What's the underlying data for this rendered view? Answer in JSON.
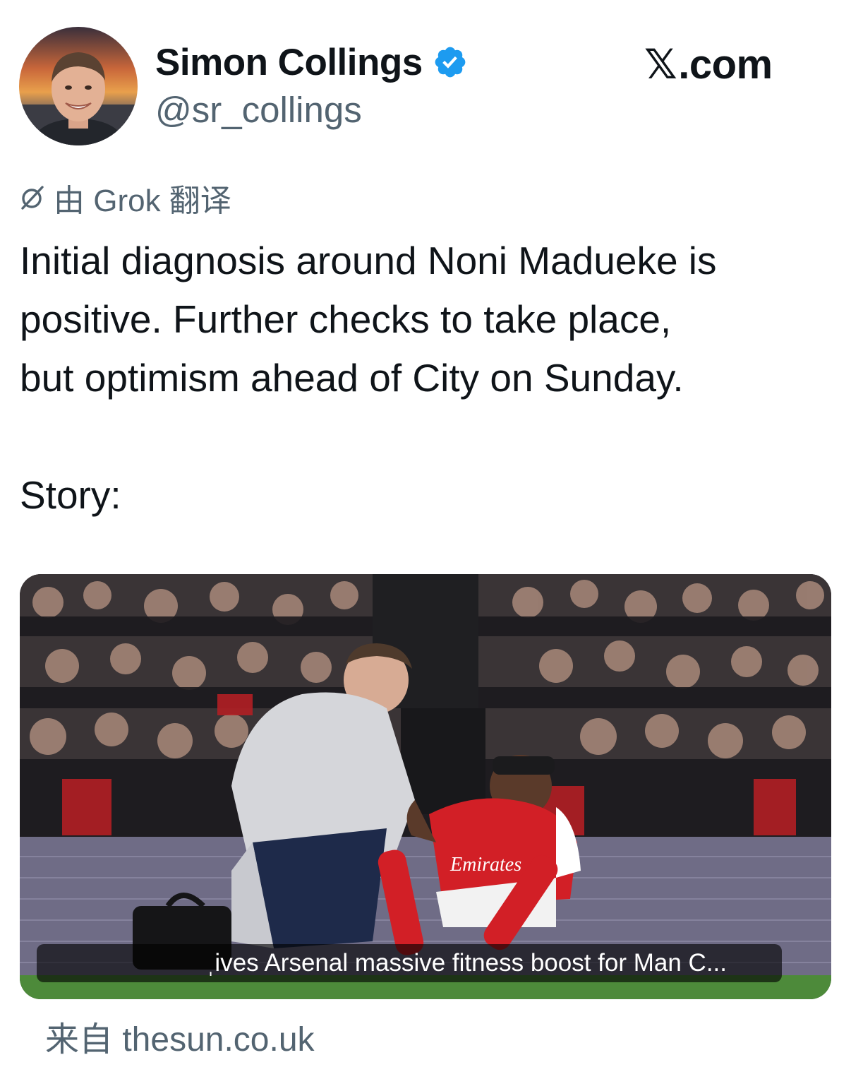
{
  "author": {
    "display_name": "Simon Collings",
    "handle": "@sr_collings",
    "verified": true,
    "verified_color": "#1d9bf0",
    "avatar_icon": "profile-photo"
  },
  "brand": {
    "x_glyph": "𝕏",
    "suffix": ".com"
  },
  "translation": {
    "icon": "grok-icon",
    "label": "由 Grok 翻译"
  },
  "tweet": {
    "lines": [
      "Initial diagnosis around Noni Madueke is",
      "positive. Further checks to take place,",
      "but optimism ahead of City on Sunday.",
      "Story:"
    ]
  },
  "link_card": {
    "title": "ˌives Arsenal massive fitness boost for Man C...",
    "source": "来自 thesun.co.uk"
  },
  "colors": {
    "text_primary": "#0f1419",
    "text_secondary": "#536471",
    "accent": "#1d9bf0"
  }
}
